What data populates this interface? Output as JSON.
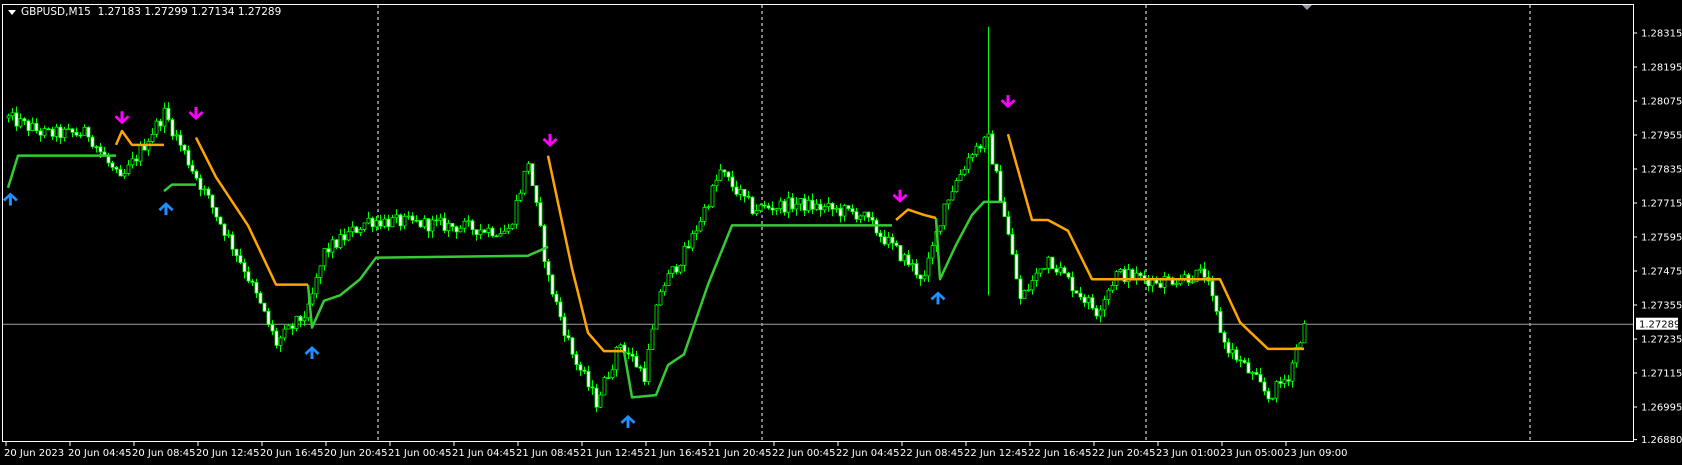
{
  "header": {
    "symbol": "GBPUSD,M15",
    "ohlc": "1.27183 1.27299 1.27134 1.27289"
  },
  "colors": {
    "background": "#000000",
    "candle_wick": "#00ff00",
    "bull_body": "#000000",
    "bear_body": "#ffffff",
    "upper_line": "#ffa500",
    "lower_line": "#32cd32",
    "sell_arrow": "#ff00ff",
    "buy_arrow": "#1e90ff",
    "grid": "#ffffff",
    "bid_line": "#a0a0a0"
  },
  "chart_data": {
    "type": "candlestick",
    "symbol": "GBPUSD",
    "timeframe": "M15",
    "ylim": [
      1.2688,
      1.2834
    ],
    "price_ticks": [
      "1.28315",
      "1.28195",
      "1.28075",
      "1.27955",
      "1.27835",
      "1.27715",
      "1.27595",
      "1.27475",
      "1.27355",
      "1.27235",
      "1.27115",
      "1.26995",
      "1.26880"
    ],
    "current_price": "1.27289",
    "time_labels": [
      "20 Jun 2023",
      "20 Jun 04:45",
      "20 Jun 08:45",
      "20 Jun 12:45",
      "20 Jun 16:45",
      "20 Jun 20:45",
      "21 Jun 00:45",
      "21 Jun 04:45",
      "21 Jun 08:45",
      "21 Jun 12:45",
      "21 Jun 16:45",
      "21 Jun 20:45",
      "22 Jun 00:45",
      "22 Jun 04:45",
      "22 Jun 08:45",
      "22 Jun 12:45",
      "22 Jun 16:45",
      "22 Jun 20:45",
      "23 Jun 01:00",
      "23 Jun 05:00",
      "23 Jun 09:00"
    ],
    "bars_per_label": 16,
    "day_separator_bars": [
      92.5,
      188.5,
      284.5,
      380.5
    ],
    "close_path": [
      [
        0,
        1.28015
      ],
      [
        9,
        1.27959
      ],
      [
        20,
        1.2796
      ],
      [
        28,
        1.2779
      ],
      [
        39,
        1.28033
      ],
      [
        45,
        1.27863
      ],
      [
        52,
        1.27673
      ],
      [
        59,
        1.27485
      ],
      [
        67,
        1.2722
      ],
      [
        75,
        1.27334
      ],
      [
        79,
        1.27542
      ],
      [
        90,
        1.27655
      ],
      [
        106,
        1.2764
      ],
      [
        125,
        1.27615
      ],
      [
        130,
        1.27863
      ],
      [
        135,
        1.27447
      ],
      [
        141,
        1.27182
      ],
      [
        147,
        1.27013
      ],
      [
        153,
        1.2722
      ],
      [
        159,
        1.27108
      ],
      [
        163,
        1.27408
      ],
      [
        170,
        1.2756
      ],
      [
        178,
        1.27825
      ],
      [
        186,
        1.27694
      ],
      [
        197,
        1.27712
      ],
      [
        213,
        1.27676
      ],
      [
        221,
        1.2756
      ],
      [
        229,
        1.27447
      ],
      [
        234,
        1.27712
      ],
      [
        241,
        1.27902
      ],
      [
        245,
        1.27937
      ],
      [
        249,
        1.27676
      ],
      [
        253,
        1.27373
      ],
      [
        260,
        1.27525
      ],
      [
        267,
        1.27408
      ],
      [
        272,
        1.27334
      ],
      [
        277,
        1.27465
      ],
      [
        288,
        1.2744
      ],
      [
        299,
        1.27465
      ],
      [
        304,
        1.2722
      ],
      [
        312,
        1.27087
      ],
      [
        315,
        1.2703
      ],
      [
        320,
        1.27108
      ],
      [
        324,
        1.27289
      ]
    ],
    "spike": {
      "bar": 245,
      "high": 1.28337,
      "low": 1.27389
    },
    "upper_line_segments": [
      [
        [
          27,
          1.2792
        ],
        [
          28.5,
          1.27969
        ],
        [
          31,
          1.2792
        ],
        [
          39,
          1.2792
        ]
      ],
      [
        [
          47,
          1.27946
        ],
        [
          52,
          1.27806
        ],
        [
          60,
          1.27636
        ],
        [
          67,
          1.27427
        ],
        [
          75,
          1.27427
        ]
      ],
      [
        [
          135,
          1.27882
        ],
        [
          141,
          1.27484
        ],
        [
          145,
          1.27257
        ],
        [
          149,
          1.27192
        ],
        [
          154,
          1.27192
        ]
      ],
      [
        [
          222,
          1.27655
        ],
        [
          225,
          1.27692
        ],
        [
          229,
          1.27673
        ],
        [
          232,
          1.27662
        ]
      ],
      [
        [
          250,
          1.27958
        ],
        [
          256,
          1.27655
        ],
        [
          260,
          1.27655
        ],
        [
          265,
          1.27617
        ],
        [
          271,
          1.27446
        ],
        [
          303,
          1.27446
        ],
        [
          308,
          1.27294
        ],
        [
          315,
          1.272
        ],
        [
          324,
          1.272
        ]
      ]
    ],
    "lower_line_segments": [
      [
        [
          0,
          1.27769
        ],
        [
          2.5,
          1.27882
        ],
        [
          27,
          1.27882
        ]
      ],
      [
        [
          39,
          1.27757
        ],
        [
          41,
          1.2778
        ],
        [
          47,
          1.2778
        ]
      ],
      [
        [
          75,
          1.27427
        ],
        [
          76,
          1.27275
        ],
        [
          79,
          1.2737
        ],
        [
          83,
          1.27389
        ],
        [
          88,
          1.27446
        ],
        [
          92,
          1.27522
        ],
        [
          130,
          1.27529
        ],
        [
          135,
          1.2756
        ]
      ],
      [
        [
          154,
          1.27192
        ],
        [
          156,
          1.27029
        ],
        [
          162,
          1.27037
        ],
        [
          165,
          1.27143
        ],
        [
          169,
          1.27181
        ],
        [
          175,
          1.27427
        ],
        [
          181,
          1.27636
        ],
        [
          221,
          1.27636
        ]
      ],
      [
        [
          232,
          1.27662
        ],
        [
          233,
          1.27446
        ],
        [
          237,
          1.27567
        ],
        [
          241,
          1.27673
        ],
        [
          244,
          1.27719
        ],
        [
          249,
          1.27719
        ]
      ]
    ],
    "sell_arrows": [
      [
        28.5,
        1.28007
      ],
      [
        47,
        1.28022
      ],
      [
        135.5,
        1.27927
      ],
      [
        223,
        1.2773
      ],
      [
        250,
        1.28064
      ]
    ],
    "buy_arrows": [
      [
        0.6,
        1.27738
      ],
      [
        39.5,
        1.27704
      ],
      [
        76,
        1.27196
      ],
      [
        155,
        1.26953
      ],
      [
        232.5,
        1.27389
      ]
    ]
  }
}
